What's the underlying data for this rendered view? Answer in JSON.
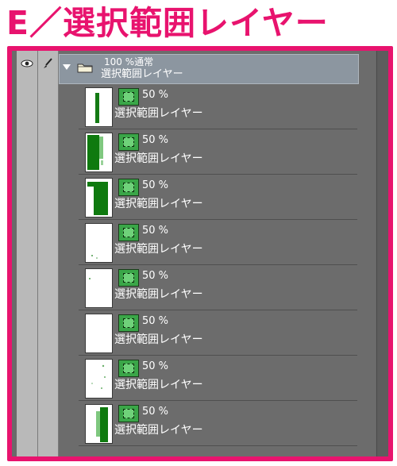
{
  "heading": "E／選択範囲レイヤー",
  "colors": {
    "accent": "#e8136e",
    "panel": "#6c6c6c",
    "folder_row": "#8c96a0",
    "selection_green": "#3aa648"
  },
  "header_icons": {
    "visibility": "eye-icon",
    "lock": "brush-icon"
  },
  "folder": {
    "opacity_mode": "100 %通常",
    "name": "選択範囲レイヤー",
    "icon": "folder-icon",
    "expanded": true
  },
  "layers": [
    {
      "opacity": "50 %",
      "name": "選択範囲レイヤー",
      "thumb": "thin-bar"
    },
    {
      "opacity": "50 %",
      "name": "選択範囲レイヤー",
      "thumb": "dense-left"
    },
    {
      "opacity": "50 %",
      "name": "選択範囲レイヤー",
      "thumb": "solid-block"
    },
    {
      "opacity": "50 %",
      "name": "選択範囲レイヤー",
      "thumb": "sparse"
    },
    {
      "opacity": "50 %",
      "name": "選択範囲レイヤー",
      "thumb": "dot"
    },
    {
      "opacity": "50 %",
      "name": "選択範囲レイヤー",
      "thumb": "empty"
    },
    {
      "opacity": "50 %",
      "name": "選択範囲レイヤー",
      "thumb": "sparse-mid"
    },
    {
      "opacity": "50 %",
      "name": "選択範囲レイヤー",
      "thumb": "tall-bar"
    }
  ]
}
